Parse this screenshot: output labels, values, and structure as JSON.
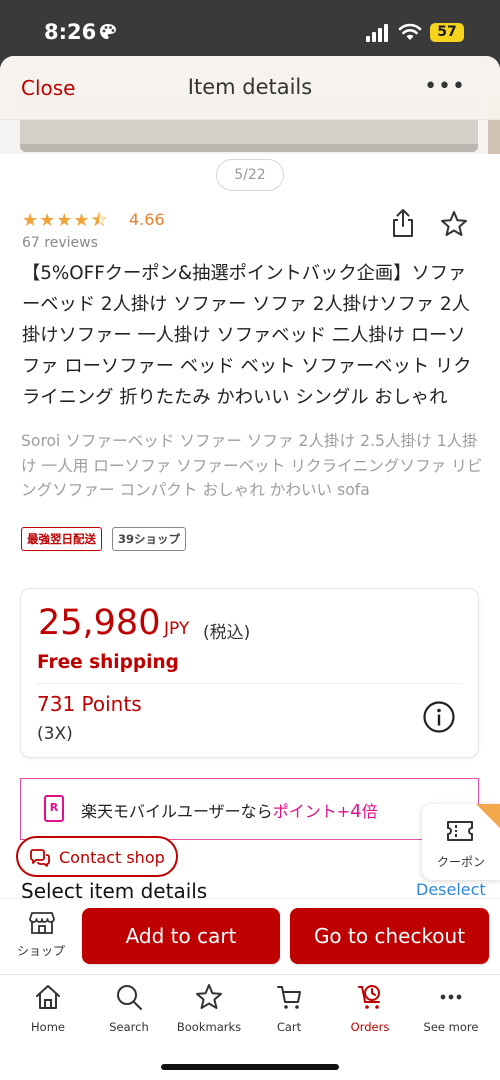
{
  "status_bar": {
    "time": "8:26",
    "battery": "57"
  },
  "header": {
    "close_label": "Close",
    "title": "Item details",
    "more_label": "•••"
  },
  "gallery": {
    "pager": "5/22"
  },
  "rating": {
    "stars": "★★★★⯪",
    "value": "4.66",
    "reviews": "67 reviews"
  },
  "product": {
    "title": "【5%OFFクーポン&抽選ポイントバック企画】ソファーベッド 2人掛け ソファー ソファ 2人掛けソファ 2人掛けソファー 一人掛け ソファベッド 二人掛け ローソファ ローソファー ベッド ベット ソファーベット リクライニング 折りたたみ かわいい シングル おしゃれ",
    "subtitle": "Soroi ソファーベッド ソファー ソファ 2人掛け 2.5人掛け 1人掛け 一人用 ローソファ ソファーベット リクライニングソファ リビングソファー コンパクト おしゃれ かわいい sofa",
    "tags": [
      "最強翌日配送",
      "39ショップ"
    ]
  },
  "price": {
    "amount": "25,980",
    "currency": "JPY",
    "tax": "(税込)",
    "shipping": "Free shipping",
    "points": "731 Points",
    "points_multiplier": "(3X)"
  },
  "mobile_banner": {
    "logo": "R",
    "text_prefix": "楽天モバイルユーザーなら",
    "text_highlight": "ポイント+",
    "text_number": "4",
    "text_suffix": "倍"
  },
  "coupon": {
    "label": "クーポン"
  },
  "contact": {
    "label": "Contact shop"
  },
  "options": {
    "heading": "Select item details",
    "deselect": "Deselect"
  },
  "actions": {
    "shop_label": "ショップ",
    "add_to_cart": "Add to cart",
    "checkout": "Go to checkout"
  },
  "tabs": [
    {
      "label": "Home",
      "icon": "home-icon"
    },
    {
      "label": "Search",
      "icon": "search-icon"
    },
    {
      "label": "Bookmarks",
      "icon": "star-icon"
    },
    {
      "label": "Cart",
      "icon": "cart-icon"
    },
    {
      "label": "Orders",
      "icon": "orders-icon"
    },
    {
      "label": "See more",
      "icon": "more-icon"
    }
  ],
  "colors": {
    "brand_red": "#bf0000",
    "rating_orange": "#f1a43a",
    "link_blue": "#2f86d8",
    "mobile_pink": "#e0118c"
  }
}
